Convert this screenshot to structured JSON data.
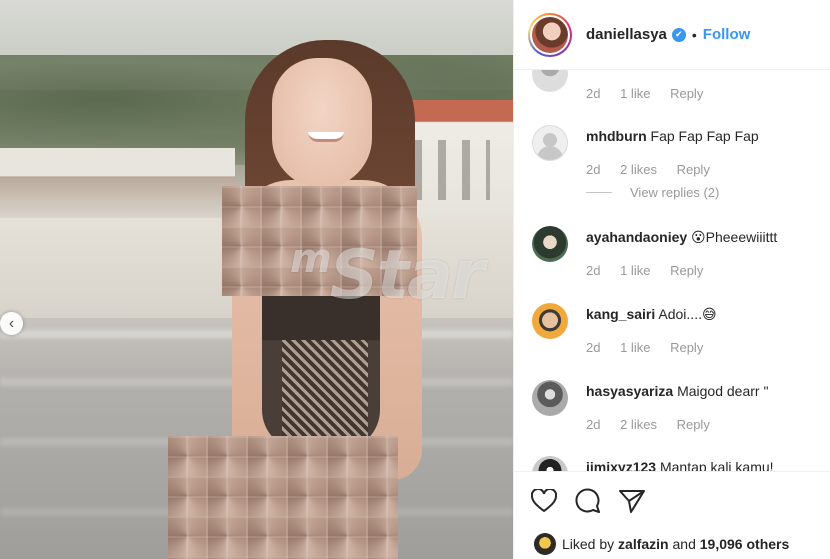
{
  "post": {
    "username": "daniellasya",
    "follow_label": "Follow",
    "separator": "•",
    "verified_glyph": "✔"
  },
  "watermark": {
    "prefix": "m",
    "main": "Star"
  },
  "carousel": {
    "prev_icon": "chevron-left-icon",
    "prev_glyph": "‹"
  },
  "comments": [
    {
      "username": "",
      "text": "",
      "age": "2d",
      "likes": "1 like",
      "reply_label": "Reply",
      "avatar": "av0"
    },
    {
      "username": "mhdburn",
      "text": "Fap Fap Fap Fap",
      "age": "2d",
      "likes": "2 likes",
      "reply_label": "Reply",
      "avatar": "default",
      "view_replies": "View replies (2)"
    },
    {
      "username": "ayahandaoniey",
      "text": "😮Pheeewiiittt",
      "age": "2d",
      "likes": "1 like",
      "reply_label": "Reply",
      "avatar": "av1"
    },
    {
      "username": "kang_sairi",
      "text": "Adoi....😅",
      "age": "2d",
      "likes": "1 like",
      "reply_label": "Reply",
      "avatar": "av2"
    },
    {
      "username": "hasyasyariza",
      "text": "Maigod dearr \"",
      "age": "2d",
      "likes": "2 likes",
      "reply_label": "Reply",
      "avatar": "av3"
    },
    {
      "username": "jimixyz123",
      "text": "Mantap kali kamu!",
      "age": "",
      "likes": "",
      "reply_label": "",
      "avatar": "av4"
    }
  ],
  "actions": {
    "like_icon": "heart-icon",
    "comment_icon": "comment-icon",
    "share_icon": "share-icon"
  },
  "likes_line": {
    "prefix": "Liked by",
    "user": "zalfazin",
    "conjunction": "and",
    "others": "19,096 others"
  },
  "colors": {
    "accent": "#3897f0",
    "text": "#262626",
    "muted": "#999999",
    "border": "#efefef"
  }
}
